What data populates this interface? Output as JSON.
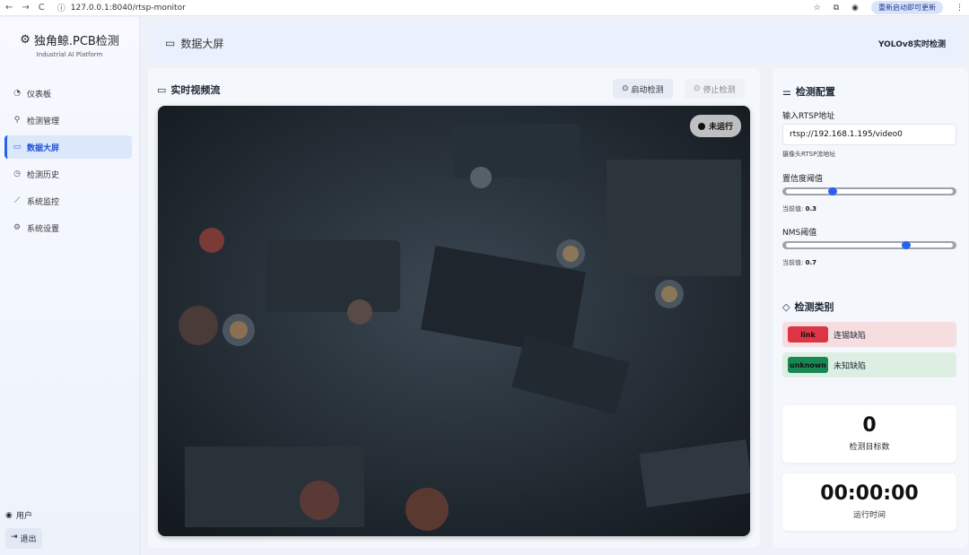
{
  "browser": {
    "back": "←",
    "forward": "→",
    "reload": "C",
    "url": "127.0.0.1:8040/rtsp-monitor",
    "update_pill": "重新启动即可更新"
  },
  "sidebar": {
    "brand_title": "独角鲸.PCB检测",
    "brand_subtitle": "Industrial AI Platform",
    "items": [
      {
        "label": "仪表板",
        "icon": "dashboard-icon"
      },
      {
        "label": "检测管理",
        "icon": "search-icon"
      },
      {
        "label": "数据大屏",
        "icon": "monitor-icon"
      },
      {
        "label": "检测历史",
        "icon": "clock-icon"
      },
      {
        "label": "系统监控",
        "icon": "chart-line-icon"
      },
      {
        "label": "系统设置",
        "icon": "gear-icon"
      }
    ],
    "user_label": "用户",
    "logout_label": "退出"
  },
  "header": {
    "title": "数据大屏",
    "model": "YOLOv8实时检测"
  },
  "video_panel": {
    "title": "实时视频流",
    "start_label": "启动检测",
    "stop_label": "停止检测",
    "status": "未运行"
  },
  "config": {
    "title": "检测配置",
    "rtsp_label": "输入RTSP地址",
    "rtsp_value": "rtsp://192.168.1.195/video0",
    "rtsp_hint": "摄像头RTSP流地址",
    "conf_label": "置信度阈值",
    "conf_prefix": "当前值:",
    "conf_value": "0.3",
    "nms_label": "NMS阈值",
    "nms_prefix": "当前值:",
    "nms_value": "0.7"
  },
  "classes": {
    "title": "检测类别",
    "items": [
      {
        "tag": "link",
        "label": "连锡缺陷",
        "tag_color": "#dc3545",
        "bg": "#f6dde0"
      },
      {
        "tag": "unknown",
        "label": "未知缺陷",
        "tag_color": "#198754",
        "bg": "#dcefe2"
      }
    ]
  },
  "stats": {
    "count_value": "0",
    "count_label": "检测目标数",
    "time_value": "00:00:00",
    "time_label": "运行时间"
  },
  "colors": {
    "accent": "#2563eb"
  }
}
